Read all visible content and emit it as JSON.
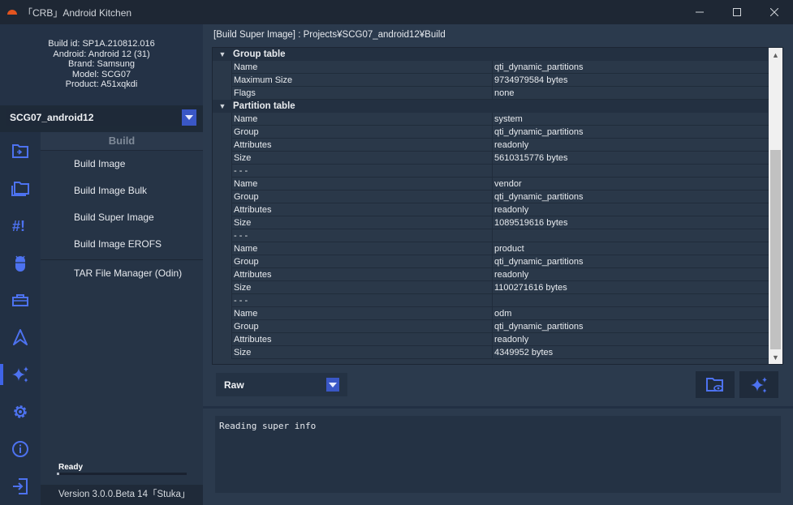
{
  "window": {
    "title": "「CRB」Android Kitchen",
    "controls": [
      "minimize",
      "maximize",
      "close"
    ]
  },
  "device_info": {
    "build_id": "Build id: SP1A.210812.016",
    "android": "Android: Android 12 (31)",
    "brand": "Brand: Samsung",
    "model": "Model: SCG07",
    "product": "Product: A51xqkdi"
  },
  "project_select": {
    "value": "SCG07_android12"
  },
  "icon_rail": [
    {
      "name": "folder-transfer-icon",
      "active": false
    },
    {
      "name": "folders-icon",
      "active": false
    },
    {
      "name": "hash-bang-icon",
      "active": false
    },
    {
      "name": "android-icon",
      "active": false
    },
    {
      "name": "toolbox-icon",
      "active": false
    },
    {
      "name": "compass-icon",
      "active": false
    },
    {
      "name": "sparkles-icon",
      "active": true
    },
    {
      "name": "gear-icon",
      "active": false
    },
    {
      "name": "info-icon",
      "active": false
    },
    {
      "name": "exit-icon",
      "active": false
    }
  ],
  "build_menu": {
    "header": "Build",
    "items": [
      "Build Image",
      "Build Image Bulk",
      "Build Super Image",
      "Build Image EROFS"
    ],
    "extra_item": "TAR File Manager (Odin)"
  },
  "status": {
    "text": "Ready",
    "progress": 0.02
  },
  "version": "Version 3.0.0.Beta 14「Stuka」",
  "path_label": "[Build Super Image] : Projects¥SCG07_android12¥Build",
  "tree": [
    {
      "type": "section",
      "title": "Group table"
    },
    {
      "type": "item",
      "key": "Name",
      "value": "qti_dynamic_partitions"
    },
    {
      "type": "item",
      "key": "Maximum Size",
      "value": "9734979584 bytes"
    },
    {
      "type": "item",
      "key": "Flags",
      "value": "none"
    },
    {
      "type": "section",
      "title": "Partition table"
    },
    {
      "type": "item",
      "key": "Name",
      "value": "system"
    },
    {
      "type": "item",
      "key": "Group",
      "value": "qti_dynamic_partitions"
    },
    {
      "type": "item",
      "key": "Attributes",
      "value": "readonly"
    },
    {
      "type": "item",
      "key": "Size",
      "value": "5610315776 bytes"
    },
    {
      "type": "item",
      "key": "- - -",
      "value": ""
    },
    {
      "type": "item",
      "key": "Name",
      "value": "vendor"
    },
    {
      "type": "item",
      "key": "Group",
      "value": "qti_dynamic_partitions"
    },
    {
      "type": "item",
      "key": "Attributes",
      "value": "readonly"
    },
    {
      "type": "item",
      "key": "Size",
      "value": "1089519616 bytes"
    },
    {
      "type": "item",
      "key": "- - -",
      "value": ""
    },
    {
      "type": "item",
      "key": "Name",
      "value": "product"
    },
    {
      "type": "item",
      "key": "Group",
      "value": "qti_dynamic_partitions"
    },
    {
      "type": "item",
      "key": "Attributes",
      "value": "readonly"
    },
    {
      "type": "item",
      "key": "Size",
      "value": "1100271616 bytes"
    },
    {
      "type": "item",
      "key": "- - -",
      "value": ""
    },
    {
      "type": "item",
      "key": "Name",
      "value": "odm"
    },
    {
      "type": "item",
      "key": "Group",
      "value": "qti_dynamic_partitions"
    },
    {
      "type": "item",
      "key": "Attributes",
      "value": "readonly"
    },
    {
      "type": "item",
      "key": "Size",
      "value": "4349952 bytes"
    }
  ],
  "mode_select": {
    "value": "Raw"
  },
  "actions": [
    {
      "name": "open-folder-view-button",
      "icon": "folder-eye-icon"
    },
    {
      "name": "build-button",
      "icon": "sparkles-icon"
    }
  ],
  "log": "Reading super info",
  "colors": {
    "accent": "#3a57c6",
    "active_bar": "#3f64e8",
    "icon": "#4d72f0"
  }
}
